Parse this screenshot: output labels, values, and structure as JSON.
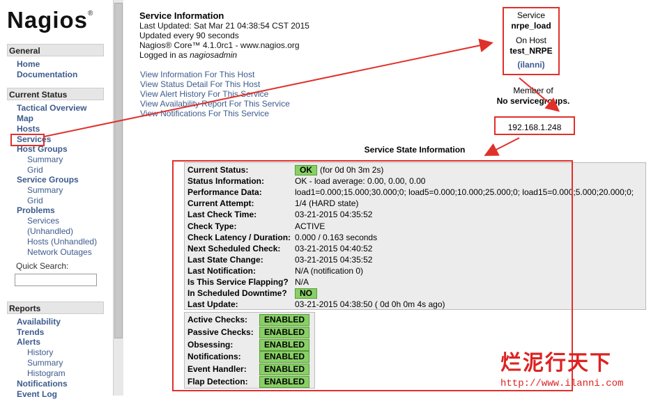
{
  "sidebar": {
    "logo": "Nagios",
    "logo_mark": "®",
    "general_heading": "General",
    "general_items": [
      "Home",
      "Documentation"
    ],
    "current_status_heading": "Current Status",
    "status_items": [
      "Tactical Overview",
      "Map",
      "Hosts",
      "Services",
      "Host Groups"
    ],
    "host_groups_sub": [
      "Summary",
      "Grid"
    ],
    "service_groups": "Service Groups",
    "service_groups_sub": [
      "Summary",
      "Grid"
    ],
    "problems": "Problems",
    "problems_services": "Services",
    "problems_services_unhandled": "(Unhandled)",
    "problems_hosts": "Hosts",
    "problems_hosts_unhandled": "(Unhandled)",
    "network_outages": "Network Outages",
    "quick_search_label": "Quick Search:",
    "quick_search_value": "",
    "reports_heading": "Reports",
    "reports_items": [
      "Availability",
      "Trends",
      "Alerts"
    ],
    "alerts_sub": [
      "History",
      "Summary",
      "Histogram"
    ],
    "notifications": "Notifications",
    "event_log": "Event Log"
  },
  "info": {
    "title": "Service Information",
    "last_updated": "Last Updated: Sat Mar 21 04:38:54 CST 2015",
    "updated_every": "Updated every 90 seconds",
    "version": "Nagios® Core™ 4.1.0rc1 - www.nagios.org",
    "logged_in_prefix": "Logged in as ",
    "logged_in_user": "nagiosadmin",
    "links": [
      "View Information For This Host",
      "View Status Detail For This Host",
      "View Alert History For This Service",
      "View Availability Report For This Service",
      "View Notifications For This Service"
    ]
  },
  "service_box": {
    "service_label": "Service",
    "service_name": "nrpe_load",
    "on_host_label": "On Host",
    "host_name": "test_NRPE",
    "alias": "(ilanni)"
  },
  "member_of": "Member of",
  "no_servicegroups": "No servicegroups.",
  "host_ip": "192.168.1.248",
  "state_heading": "Service State Information",
  "state": {
    "rows": [
      {
        "label": "Current Status:",
        "badge": "OK",
        "value": "(for 0d 0h 3m 2s)"
      },
      {
        "label": "Status Information:",
        "value": "OK - load average: 0.00, 0.00, 0.00"
      },
      {
        "label": "Performance Data:",
        "value": "load1=0.000;15.000;30.000;0; load5=0.000;10.000;25.000;0; load15=0.000;5.000;20.000;0;"
      },
      {
        "label": "Current Attempt:",
        "value": "1/4  (HARD state)"
      },
      {
        "label": "Last Check Time:",
        "value": "03-21-2015 04:35:52"
      },
      {
        "label": "Check Type:",
        "value": "ACTIVE"
      },
      {
        "label": "Check Latency / Duration:",
        "value": "0.000 / 0.163 seconds"
      },
      {
        "label": "Next Scheduled Check:",
        "value": "03-21-2015 04:40:52"
      },
      {
        "label": "Last State Change:",
        "value": "03-21-2015 04:35:52"
      },
      {
        "label": "Last Notification:",
        "value": "N/A (notification 0)"
      },
      {
        "label": "Is This Service Flapping?",
        "value": "N/A"
      },
      {
        "label": "In Scheduled Downtime?",
        "badge": "NO",
        "value": ""
      },
      {
        "label": "Last Update:",
        "value": "03-21-2015 04:38:50  ( 0d 0h 0m 4s ago)"
      }
    ]
  },
  "checks": [
    {
      "label": "Active Checks:",
      "value": "ENABLED"
    },
    {
      "label": "Passive Checks:",
      "value": "ENABLED"
    },
    {
      "label": "Obsessing:",
      "value": "ENABLED"
    },
    {
      "label": "Notifications:",
      "value": "ENABLED"
    },
    {
      "label": "Event Handler:",
      "value": "ENABLED"
    },
    {
      "label": "Flap Detection:",
      "value": "ENABLED"
    }
  ],
  "watermark": {
    "text": "烂泥行天下",
    "url": "http://www.ilanni.com"
  },
  "colors": {
    "annotation_red": "#e0302a",
    "link_blue": "#3c5b8d",
    "ok_green": "#88d066"
  }
}
